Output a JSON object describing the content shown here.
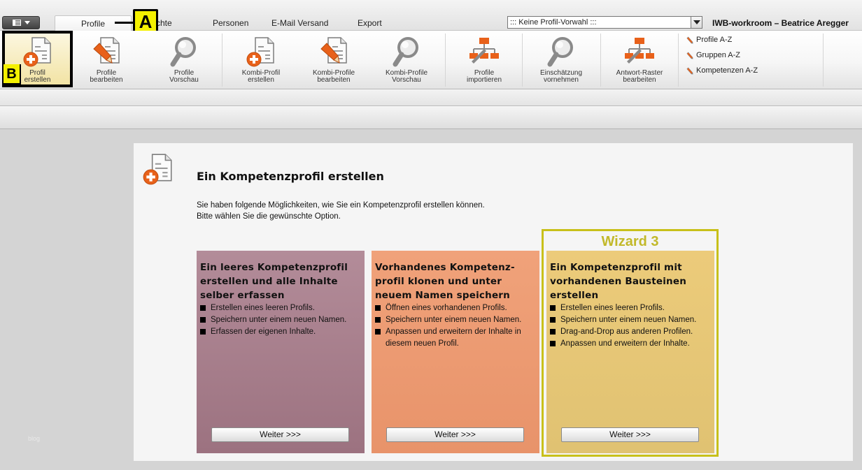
{
  "tabs": {
    "items": [
      {
        "label": "Profile"
      },
      {
        "label": "chte"
      },
      {
        "label": "Personen"
      },
      {
        "label": "E-Mail Versand"
      },
      {
        "label": "Export"
      }
    ]
  },
  "callouts": {
    "a": "A",
    "b": "B"
  },
  "header": {
    "profile_select": "::: Keine Profil-Vorwahl :::",
    "workspace": "IWB-workroom – Beatrice Aregger"
  },
  "ribbon": {
    "buttons": [
      {
        "line1": "Profil",
        "line2": "erstellen",
        "icon": "doc-add-icon"
      },
      {
        "line1": "Profile",
        "line2": "bearbeiten",
        "icon": "doc-edit-icon"
      },
      {
        "line1": "Profile",
        "line2": "Vorschau",
        "icon": "magnifier-icon"
      },
      {
        "line1": "Kombi-Profil",
        "line2": "erstellen",
        "icon": "doc-add-icon"
      },
      {
        "line1": "Kombi-Profile",
        "line2": "bearbeiten",
        "icon": "doc-edit-icon"
      },
      {
        "line1": "Kombi-Profile",
        "line2": "Vorschau",
        "icon": "magnifier-icon"
      },
      {
        "line1": "Profile",
        "line2": "importieren",
        "icon": "hierarchy-icon"
      },
      {
        "line1": "Einschätzung",
        "line2": "vornehmen",
        "icon": "magnifier-icon"
      },
      {
        "line1": "Antwort-Raster",
        "line2": "bearbeiten",
        "icon": "hierarchy-icon"
      }
    ],
    "links": [
      {
        "label": "Profile A-Z"
      },
      {
        "label": "Gruppen A-Z"
      },
      {
        "label": "Kompetenzen A-Z"
      }
    ]
  },
  "footer": {
    "blog": "blog"
  },
  "main": {
    "title": "Ein Kompetenzprofil erstellen",
    "desc_line1": "Sie haben folgende Möglichkeiten, wie Sie ein Kompetenzprofil erstellen können.",
    "desc_line2": "Bitte wählen Sie die gewünschte Option.",
    "wizard_label": "Wizard 3",
    "cards": [
      {
        "title_lines": [
          "Ein leeres Kompetenzprofil",
          "erstellen und alle Inhalte",
          "selber erfassen"
        ],
        "bullets": [
          "Erstellen eines leeren Profils.",
          "Speichern unter einem neuen Namen.",
          "Erfassen der eigenen Inhalte."
        ],
        "button": "Weiter >>>",
        "color": "#a77d8b"
      },
      {
        "title_lines": [
          "Vorhandenes Kompetenz-",
          "profil klonen und unter",
          "neuem Namen speichern"
        ],
        "bullets": [
          "Öffnen eines vorhandenen Profils.",
          "Speichern unter einem neuen Namen.",
          "Anpassen und erweitern der Inhalte in diesem neuen Profil."
        ],
        "button": "Weiter >>>",
        "color": "#ec9a71"
      },
      {
        "title_lines": [
          "Ein Kompetenzprofil mit",
          "vorhandenen Bausteinen",
          "erstellen"
        ],
        "bullets": [
          "Erstellen eines leeren Profils.",
          "Speichern unter einem neuen Namen.",
          "Drag-and-Drop aus anderen Profilen.",
          "Anpassen und erweitern der Inhalte."
        ],
        "button": "Weiter >>>",
        "color": "#e6c676"
      }
    ]
  },
  "colors": {
    "accent_orange": "#e8611a",
    "wizard_border": "#c8c01a",
    "callout_yellow": "#f4f000"
  }
}
